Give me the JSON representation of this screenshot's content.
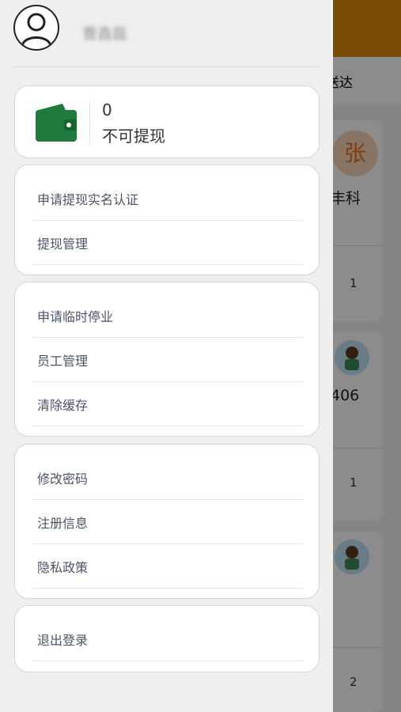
{
  "background": {
    "tab_text": "送达",
    "avatar_char": "张",
    "name_fragment": "丰科",
    "code_fragment": "406",
    "row_counts": [
      "1",
      "1",
      "2"
    ]
  },
  "drawer": {
    "user_name": "曹鑫磊",
    "wallet": {
      "amount": "0",
      "status": "不可提现",
      "icon": "wallet-icon"
    },
    "groups": [
      {
        "items": [
          "申请提现实名认证",
          "提现管理"
        ]
      },
      {
        "items": [
          "申请临时停业",
          "员工管理",
          "清除缓存"
        ]
      },
      {
        "items": [
          "修改密码",
          "注册信息",
          "隐私政策"
        ]
      },
      {
        "items": [
          "退出登录"
        ]
      }
    ]
  },
  "colors": {
    "header": "#e08a0f",
    "wallet_green": "#1f7a3e",
    "menu_text": "#4a5366"
  }
}
